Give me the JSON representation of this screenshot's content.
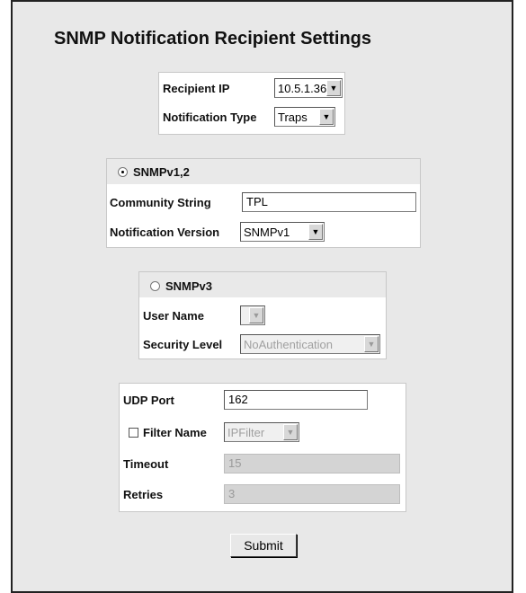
{
  "title": "SNMP Notification Recipient Settings",
  "recipient": {
    "ip_label": "Recipient IP",
    "ip_value": "10.5.1.36",
    "type_label": "Notification Type",
    "type_value": "Traps"
  },
  "snmpv12": {
    "radio_label": "SNMPv1,2",
    "selected": true,
    "community_label": "Community String",
    "community_value": "TPL",
    "version_label": "Notification Version",
    "version_value": "SNMPv1"
  },
  "snmpv3": {
    "radio_label": "SNMPv3",
    "selected": false,
    "user_label": "User Name",
    "user_value": "",
    "security_label": "Security Level",
    "security_value": "NoAuthentication"
  },
  "transport": {
    "udp_label": "UDP Port",
    "udp_value": "162",
    "filter_label": "Filter Name",
    "filter_checked": false,
    "filter_value": "IPFilter",
    "timeout_label": "Timeout",
    "timeout_value": "15",
    "retries_label": "Retries",
    "retries_value": "3"
  },
  "submit_label": "Submit"
}
